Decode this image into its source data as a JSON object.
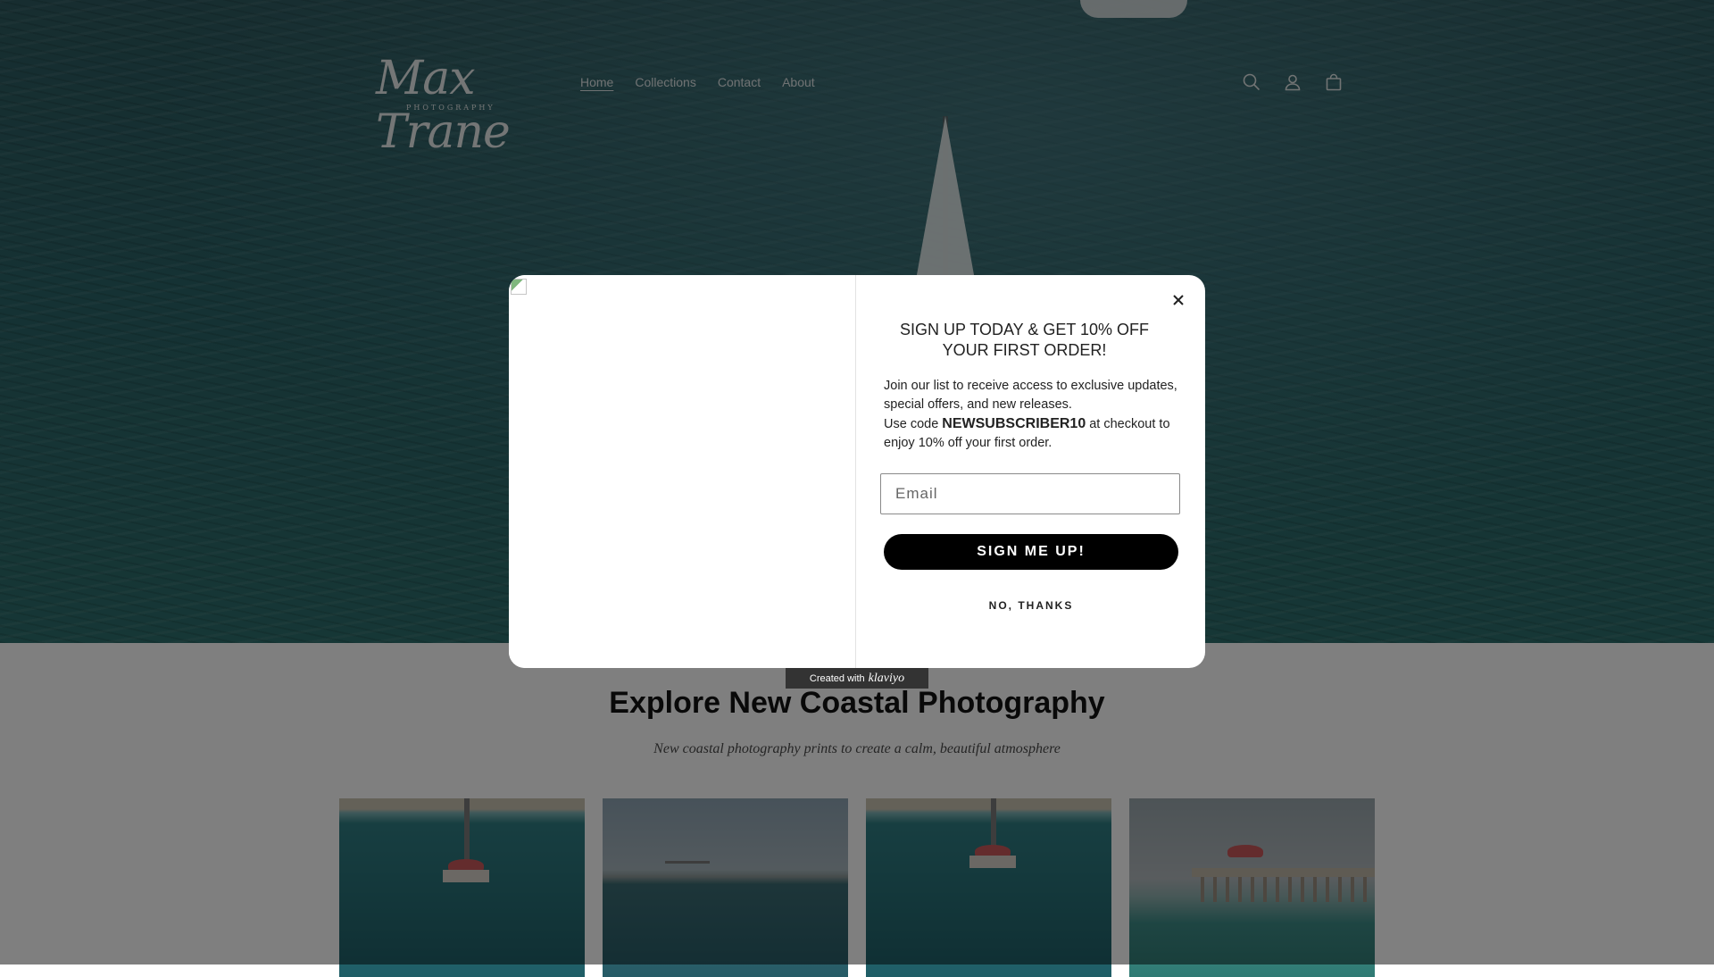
{
  "header": {
    "logo": {
      "script": "Max Trane",
      "sub": "PHOTOGRAPHY"
    },
    "nav": [
      {
        "label": "Home",
        "active": true
      },
      {
        "label": "Collections",
        "active": false
      },
      {
        "label": "Contact",
        "active": false
      },
      {
        "label": "About",
        "active": false
      }
    ],
    "icons": [
      "search-icon",
      "account-icon",
      "cart-icon"
    ]
  },
  "section": {
    "title": "Explore New Coastal Photography",
    "subtitle": "New coastal photography prints to create a calm, beautiful atmosphere"
  },
  "popup": {
    "heading": "SIGN UP TODAY & GET 10% OFF YOUR FIRST ORDER!",
    "body_line1": "Join our list to receive access to exclusive updates, special offers, and new releases.",
    "body_line2_prefix": "Use code ",
    "code": "NEWSUBSCRIBER10",
    "body_line2_suffix": " at checkout to enjoy 10% off your first order.",
    "email_placeholder": "Email",
    "submit_label": "SIGN ME UP!",
    "dismiss_label": "NO, THANKS",
    "badge_prefix": "Created with",
    "badge_brand": "klaviyo"
  },
  "colors": {
    "overlay": "rgba(0,0,0,0.5)",
    "button": "#000000",
    "ocean": "#2b6468"
  }
}
